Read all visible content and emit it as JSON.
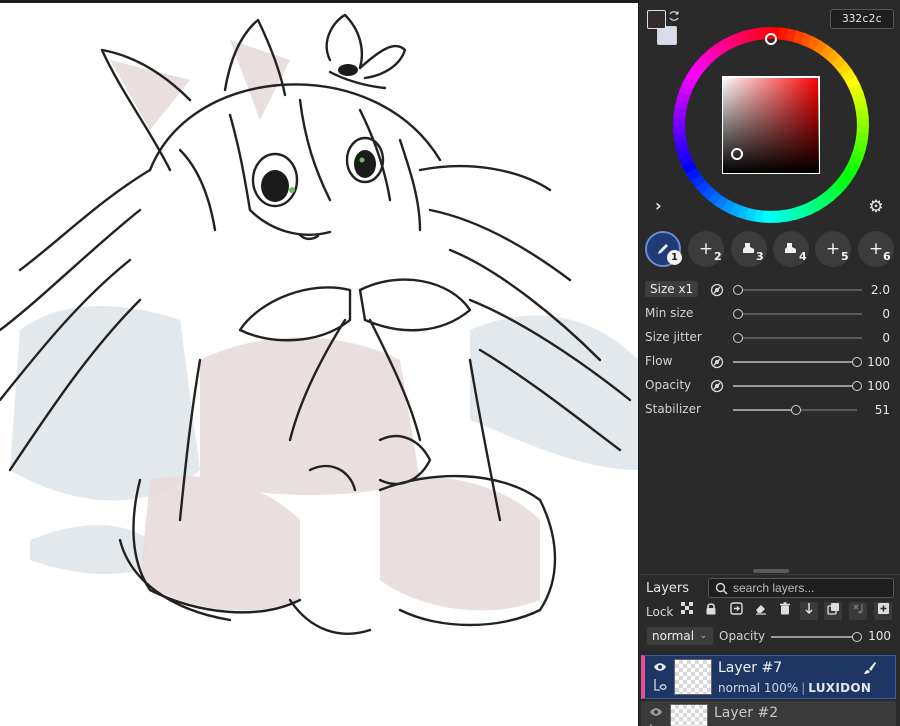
{
  "color": {
    "hex": "332c2c",
    "foreground": "#332c2c",
    "background": "#d9dcea"
  },
  "icons": {
    "swap": "swap-colors-icon",
    "expand": "chevron-right-icon",
    "settings": "gear-icon",
    "pressure": "pressure-icon",
    "search": "search-icon"
  },
  "brush_slots": [
    {
      "num": "1",
      "icon": "pencil-icon",
      "active": true
    },
    {
      "num": "2",
      "icon": "plus-icon"
    },
    {
      "num": "3",
      "icon": "stamp-icon"
    },
    {
      "num": "4",
      "icon": "stamp-icon"
    },
    {
      "num": "5",
      "icon": "plus-icon"
    },
    {
      "num": "6",
      "icon": "plus-icon"
    }
  ],
  "brush_settings": {
    "size": {
      "label": "Size x1",
      "value": "2.0",
      "fraction": 0.0
    },
    "min_size": {
      "label": "Min size",
      "value": "0",
      "fraction": 0.0
    },
    "size_jitter": {
      "label": "Size jitter",
      "value": "0",
      "fraction": 0.0
    },
    "flow": {
      "label": "Flow",
      "value": "100",
      "fraction": 1.0
    },
    "opacity": {
      "label": "Opacity",
      "value": "100",
      "fraction": 1.0
    },
    "stabilizer": {
      "label": "Stabilizer",
      "value": "51",
      "fraction": 0.51
    }
  },
  "layers": {
    "title": "Layers",
    "search_placeholder": "search layers...",
    "lock_label": "Lock",
    "blend_mode": "normal",
    "opacity_label": "Opacity",
    "opacity_value": "100",
    "opacity_fraction": 1.0,
    "items": [
      {
        "name": "Layer #7",
        "mode": "normal",
        "opacity": "100%",
        "tag": "LUXIDON",
        "selected": true
      },
      {
        "name": "Layer #2"
      }
    ]
  }
}
